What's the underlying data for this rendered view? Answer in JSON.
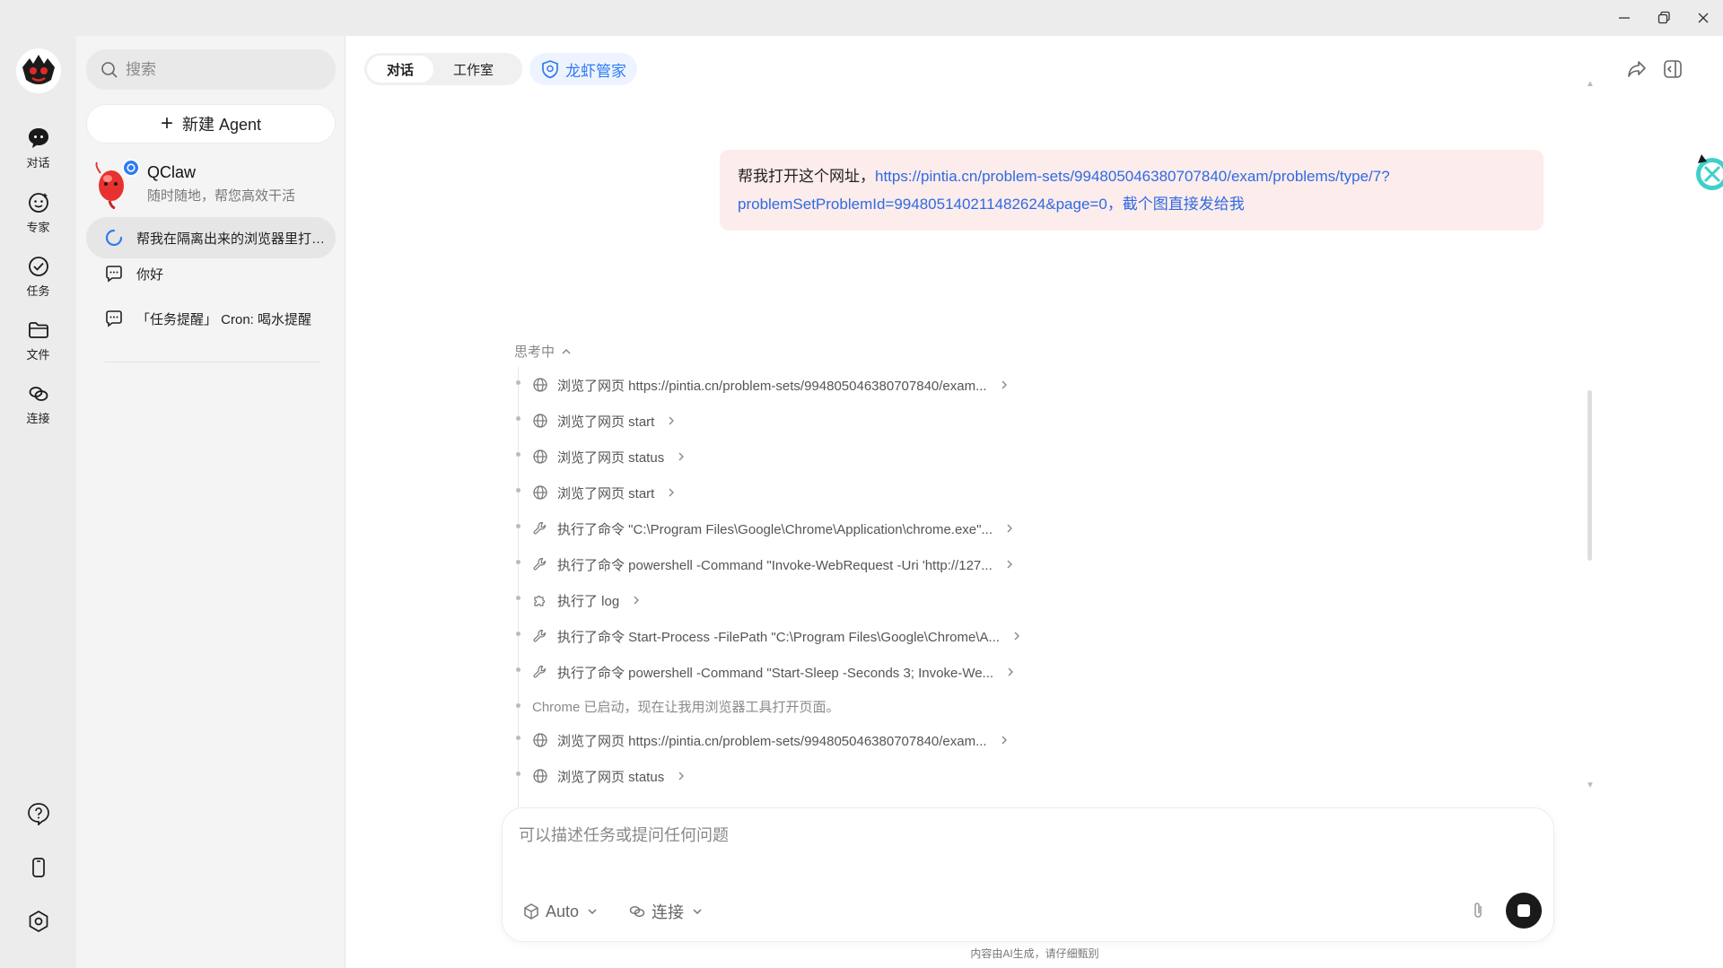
{
  "window": {
    "controls": [
      "minimize-icon",
      "restore-icon",
      "close-icon"
    ]
  },
  "rail": {
    "items": [
      {
        "label": "对话",
        "icon": "chat-icon"
      },
      {
        "label": "专家",
        "icon": "expert-icon"
      },
      {
        "label": "任务",
        "icon": "task-icon"
      },
      {
        "label": "文件",
        "icon": "folder-icon"
      },
      {
        "label": "连接",
        "icon": "link-icon"
      }
    ],
    "bottom": [
      "help-icon",
      "phone-icon",
      "settings-icon"
    ]
  },
  "sidebar": {
    "search_placeholder": "搜索",
    "new_agent_label": "新建 Agent",
    "agent": {
      "name": "QClaw",
      "subtitle": "随时随地，帮您高效干活"
    },
    "conversations": [
      {
        "label": "帮我在隔离出来的浏览器里打开这个网址",
        "icon": "loading-icon",
        "active": true
      },
      {
        "label": "你好",
        "icon": "chat-bubble-icon",
        "active": false
      },
      {
        "label": "「任务提醒」 Cron: 喝水提醒",
        "icon": "chat-bubble-icon",
        "active": false
      }
    ]
  },
  "header": {
    "tabs": [
      "对话",
      "工作室"
    ],
    "active_tab": "对话",
    "chip_label": "龙虾管家",
    "accent": "#2f7bf5"
  },
  "message": {
    "prefix": "帮我打开这个网址，",
    "link": "https://pintia.cn/problem-sets/994805046380707840/exam/problems/type/7?problemSetProblemId=994805140211482624&page=0",
    "link_line1": "https://pintia.cn/problem-sets/994805046380707840/exam/problems/type/7?",
    "link_line2": "problemSetProblemId=994805140211482624&page=0",
    "suffix": "，截个图直接发给我",
    "suffix_color": "#2f6be0",
    "bubble_color": "#fdecec"
  },
  "thinking": {
    "label": "思考中",
    "steps": [
      {
        "type": "browse",
        "icon": "globe-icon",
        "text": "浏览了网页 https://pintia.cn/problem-sets/994805046380707840/exam..."
      },
      {
        "type": "browse",
        "icon": "globe-icon",
        "text": "浏览了网页 start"
      },
      {
        "type": "browse",
        "icon": "globe-icon",
        "text": "浏览了网页 status"
      },
      {
        "type": "browse",
        "icon": "globe-icon",
        "text": "浏览了网页 start"
      },
      {
        "type": "exec",
        "icon": "wrench-icon",
        "text": "执行了命令 \"C:\\Program Files\\Google\\Chrome\\Application\\chrome.exe\"..."
      },
      {
        "type": "exec",
        "icon": "wrench-icon",
        "text": "执行了命令 powershell -Command \"Invoke-WebRequest -Uri 'http://127..."
      },
      {
        "type": "tool",
        "icon": "puzzle-icon",
        "text": "执行了 log"
      },
      {
        "type": "exec",
        "icon": "wrench-icon",
        "text": "执行了命令 Start-Process -FilePath \"C:\\Program Files\\Google\\Chrome\\A..."
      },
      {
        "type": "exec",
        "icon": "wrench-icon",
        "text": "执行了命令 powershell -Command \"Start-Sleep -Seconds 3; Invoke-We..."
      },
      {
        "type": "note",
        "icon": "",
        "text": "Chrome 已启动，现在让我用浏览器工具打开页面。"
      },
      {
        "type": "browse",
        "icon": "globe-icon",
        "text": "浏览了网页 https://pintia.cn/problem-sets/994805046380707840/exam..."
      },
      {
        "type": "browse",
        "icon": "globe-icon",
        "text": "浏览了网页 status"
      }
    ]
  },
  "composer": {
    "placeholder": "可以描述任务或提问任何问题",
    "model_label": "Auto",
    "connect_label": "连接"
  },
  "footer": {
    "disclaimer": "内容由AI生成，请仔细甄别"
  }
}
